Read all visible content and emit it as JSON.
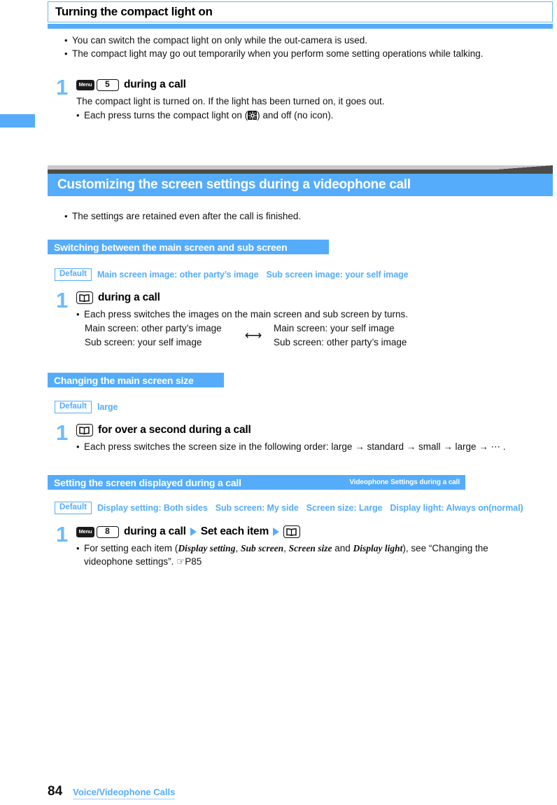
{
  "page": {
    "number": "84",
    "section_footer": "Voice/Videophone Calls"
  },
  "top_section": {
    "title": "Turning the compact light on",
    "notes": [
      "You can switch the compact light on only while the out-camera is used.",
      "The compact light may go out temporarily when you perform some setting operations while talking."
    ],
    "step": {
      "number": "1",
      "key_menu": "Menu",
      "key_num": "5",
      "head_text": "during a call",
      "desc": "The compact light is turned on. If the light has been turned on, it goes out.",
      "note_prefix": "Each press turns the compact light on (",
      "note_suffix": ") and off (no icon)."
    }
  },
  "banner": {
    "title": "Customizing the screen settings during a videophone call",
    "note": "The settings are retained even after the call is finished."
  },
  "sub1": {
    "title": "Switching between the main screen and sub screen",
    "default_label": "Default",
    "defaults": [
      "Main screen image: other party’s image",
      "Sub screen image: your self image"
    ],
    "step": {
      "number": "1",
      "head_text": "during a call",
      "note": "Each press switches the images on the main screen and sub screen by turns.",
      "left_top": "Main screen: other party’s image",
      "left_bottom": "Sub screen: your self image",
      "arrow": "⟷",
      "right_top": "Main screen: your self image",
      "right_bottom": "Sub screen: other party’s image"
    }
  },
  "sub2": {
    "title": "Changing the main screen size",
    "default_label": "Default",
    "defaults": [
      "large"
    ],
    "step": {
      "number": "1",
      "head_text": "for over a second during a call",
      "note": "Each press switches the screen size in the following order: large → standard → small → large → ⋯ ."
    }
  },
  "sub3": {
    "title": "Setting the screen displayed during a call",
    "tag": "Videophone Settings during a call",
    "default_label": "Default",
    "defaults": [
      "Display setting: Both sides",
      "Sub screen: My side",
      "Screen size: Large",
      "Display light: Always on(normal)"
    ],
    "step": {
      "number": "1",
      "key_menu": "Menu",
      "key_num": "8",
      "head_text_1": "during a call",
      "head_text_2": "Set each item",
      "note_1": "For setting each item (",
      "note_italic_1": "Display setting",
      "note_sep_1": ", ",
      "note_italic_2": "Sub screen",
      "note_sep_2": ", ",
      "note_italic_3": "Screen size",
      "note_sep_3": " and ",
      "note_italic_4": "Display light",
      "note_2": "), see “Changing the",
      "note_3": "videophone settings”.",
      "note_ref": "☞P85"
    }
  },
  "colors": {
    "accent_blue": "#55acfa",
    "step_blue": "#6bbcfb",
    "gray_dark": "#4d4b49",
    "gray_light": "#cbc9c7"
  }
}
